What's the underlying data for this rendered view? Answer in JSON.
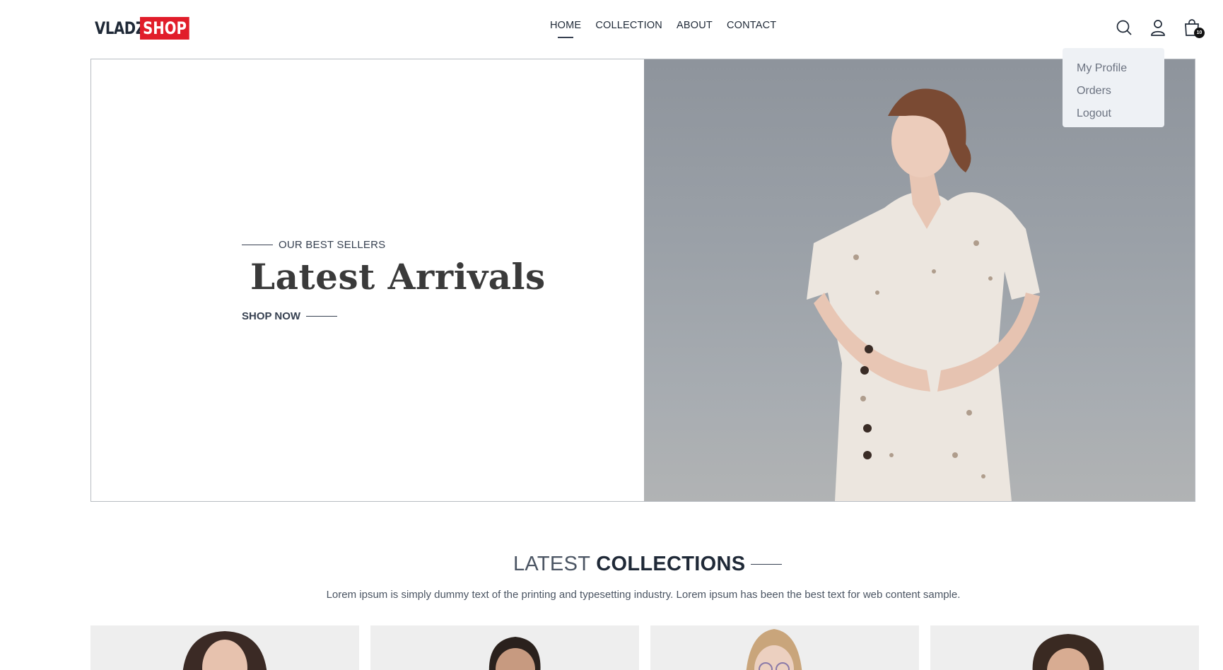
{
  "header": {
    "logo": {
      "part1": "VLADZ",
      "part2": "SHOP",
      "accent": "#e11d2a"
    },
    "nav": [
      {
        "label": "HOME",
        "active": true
      },
      {
        "label": "COLLECTION",
        "active": false
      },
      {
        "label": "ABOUT",
        "active": false
      },
      {
        "label": "CONTACT",
        "active": false
      }
    ],
    "icons": [
      "search-icon",
      "user-icon",
      "cart-icon"
    ],
    "cart_count": "10"
  },
  "dropdown": {
    "items": [
      "My Profile",
      "Orders",
      "Logout"
    ]
  },
  "hero": {
    "eyebrow": "OUR BEST SELLERS",
    "title": "Latest Arrivals",
    "cta": "SHOP NOW"
  },
  "collections": {
    "title_light": "LATEST",
    "title_bold": "COLLECTIONS",
    "description": "Lorem ipsum is simply dummy text of the printing and typesetting industry. Lorem ipsum has been the best text for web content sample."
  }
}
